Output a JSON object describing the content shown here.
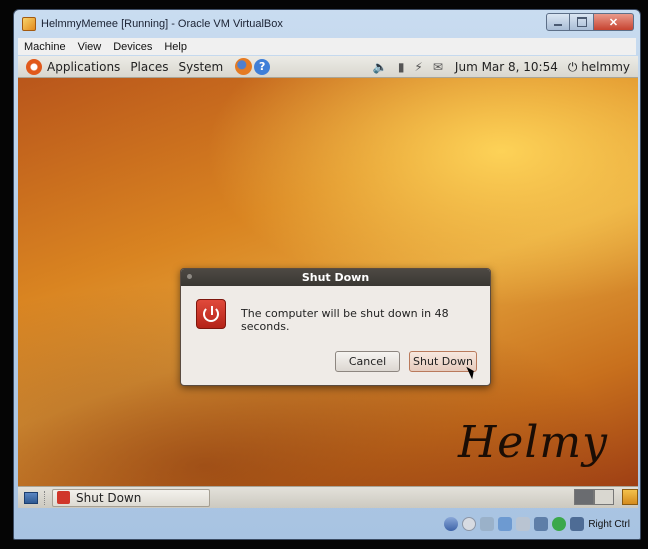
{
  "window": {
    "title": "HelmmyMemee [Running] - Oracle VM VirtualBox"
  },
  "vbox_menu": [
    "Machine",
    "View",
    "Devices",
    "Help"
  ],
  "gnome_top": {
    "menus": [
      "Applications",
      "Places",
      "System"
    ],
    "clock": "Jum Mar  8, 10:54",
    "user": "helmmy"
  },
  "dialog": {
    "title": "Shut Down",
    "message": "The computer will be shut down in 48 seconds.",
    "cancel_label": "Cancel",
    "shutdown_label": "Shut Down"
  },
  "taskbar": {
    "task_label": "Shut Down"
  },
  "signature": "Helmy",
  "vbox_status": {
    "host_key": "Right Ctrl"
  },
  "colors": {
    "accent_orange": "#e1591b",
    "dialog_title_bg": "#3a3733",
    "power_red": "#d0362a"
  }
}
